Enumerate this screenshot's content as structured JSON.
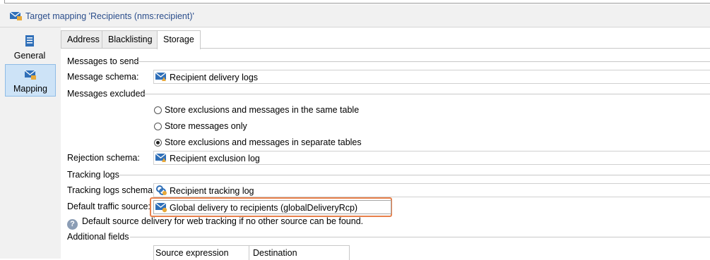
{
  "title": "Target mapping 'Recipients (nms:recipient)'",
  "side_tabs": [
    {
      "label": "General"
    },
    {
      "label": "Mapping"
    }
  ],
  "tabs": [
    {
      "label": "Address"
    },
    {
      "label": "Blacklisting"
    },
    {
      "label": "Storage"
    }
  ],
  "sections": {
    "messages_to_send": "Messages to send",
    "messages_excluded": "Messages excluded",
    "tracking_logs": "Tracking logs",
    "additional_fields": "Additional fields"
  },
  "fields": {
    "message_schema": {
      "label": "Message schema:",
      "value": "Recipient delivery logs"
    },
    "rejection_schema": {
      "label": "Rejection schema:",
      "value": "Recipient exclusion log"
    },
    "tracking_logs_schema": {
      "label": "Tracking logs schema:",
      "value": "Recipient tracking log"
    },
    "default_traffic_source": {
      "label": "Default traffic source:",
      "value": "Global delivery to recipients (globalDeliveryRcp)"
    }
  },
  "radios": [
    {
      "label": "Store exclusions and messages in the same table",
      "selected": false
    },
    {
      "label": "Store messages only",
      "selected": false
    },
    {
      "label": "Store exclusions and messages in separate tables",
      "selected": true
    }
  ],
  "hint": "Default source delivery for web tracking if no other source can be found.",
  "table": {
    "columns": [
      "Source expression",
      "Destination"
    ]
  },
  "colors": {
    "highlight": "#e7804b",
    "selected_tab_bg": "#cde3f7",
    "title_text": "#2b4e8c"
  }
}
